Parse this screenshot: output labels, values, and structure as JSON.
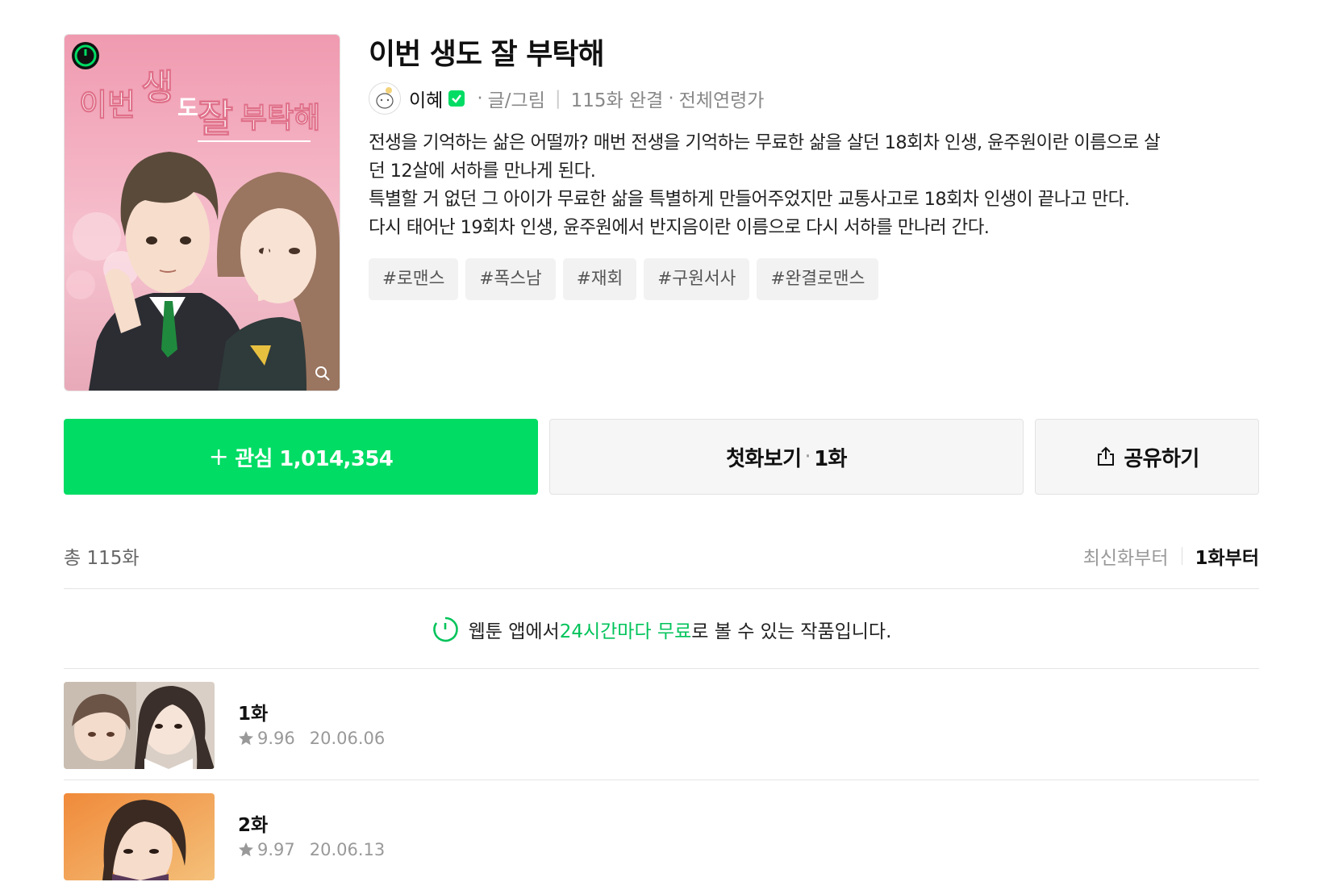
{
  "series": {
    "title": "이번 생도 잘 부탁해",
    "cover_title_text": "이번 생도 잘부탁해",
    "author": "이혜",
    "author_role": "글/그림",
    "episode_status": "115화 완결",
    "age_rating": "전체연령가",
    "description": [
      "전생을 기억하는 삶은 어떨까? 매번 전생을 기억하는 무료한 삶을 살던 18회차 인생, 윤주원이란 이름으로 살",
      "던 12살에 서하를 만나게 된다.",
      "특별할 거 없던 그 아이가 무료한 삶을 특별하게 만들어주었지만 교통사고로 18회차 인생이 끝나고 만다.",
      "다시 태어난 19회차 인생, 윤주원에서 반지음이란 이름으로 다시 서하를 만나러 간다."
    ],
    "tags": [
      "#로맨스",
      "#폭스남",
      "#재회",
      "#구원서사",
      "#완결로맨스"
    ]
  },
  "actions": {
    "favorite_label": "관심 1,014,354",
    "first_episode_label": "첫화보기",
    "first_episode_number": "1화",
    "share_label": "공유하기"
  },
  "list": {
    "total": "총 115화",
    "sort_latest": "최신화부터",
    "sort_first": "1화부터"
  },
  "notice": {
    "prefix": "웹툰 앱에서 ",
    "highlight": "24시간마다 무료",
    "suffix": "로 볼 수 있는 작품입니다."
  },
  "episodes": [
    {
      "title": "1화",
      "rating": "9.96",
      "date": "20.06.06"
    },
    {
      "title": "2화",
      "rating": "9.97",
      "date": "20.06.13"
    }
  ],
  "colors": {
    "accent": "#00dc64",
    "notice_highlight": "#00c35a"
  },
  "icons": {
    "timer_badge": "timer-icon",
    "zoom": "zoom-icon",
    "verified": "verified-check-icon",
    "share": "share-icon",
    "clock": "clock-icon",
    "star": "star-icon"
  }
}
